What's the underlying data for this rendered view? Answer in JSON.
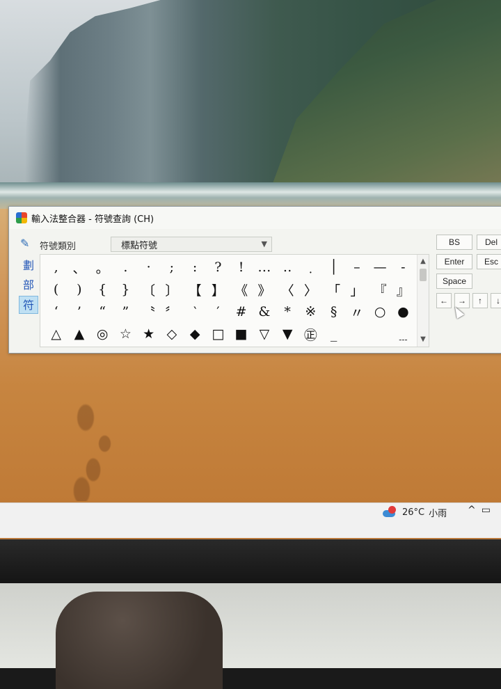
{
  "window": {
    "title": "輸入法整合器 - 符號查詢 (CH)"
  },
  "category": {
    "label": "符號類別",
    "selected": "標點符號"
  },
  "side_tabs": [
    "劃",
    "部",
    "符"
  ],
  "symbols": [
    [
      ",",
      "、",
      "。",
      ".",
      "·",
      ";",
      ":",
      "?",
      "!",
      "…",
      "‥",
      "﹒",
      "│",
      "–",
      "—",
      "-"
    ],
    [
      "(",
      ")",
      "{",
      "}",
      "〔",
      "〕",
      "【",
      "】",
      "《",
      "》",
      "〈",
      "〉",
      "「",
      "」",
      "『",
      "』"
    ],
    [
      "‘",
      "’",
      "“",
      "”",
      "〝",
      "〞",
      "‵",
      "′",
      "#",
      "&",
      "*",
      "※",
      "§",
      "〃",
      "○",
      "●"
    ],
    [
      "△",
      "▲",
      "◎",
      "☆",
      "★",
      "◇",
      "◆",
      "□",
      "■",
      "▽",
      "▼",
      "㊣",
      "_",
      "",
      "",
      "﹍"
    ]
  ],
  "keys": {
    "bs": "BS",
    "del": "Del",
    "enter": "Enter",
    "esc": "Esc",
    "space": "Space",
    "left": "←",
    "right": "→",
    "up": "↑",
    "down": "↓"
  },
  "taskbar": {
    "temperature": "26°C",
    "weather": "小雨",
    "tray_chevron": "^"
  },
  "icons": {
    "app": "ime-app-icon",
    "pen": "pen-icon",
    "weather": "cloud-rain-icon"
  }
}
